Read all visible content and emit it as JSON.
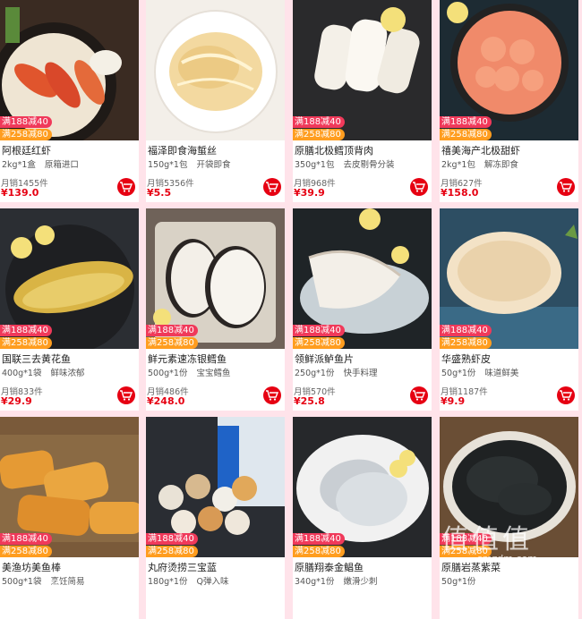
{
  "promo": {
    "tag1": "满188减40",
    "tag2": "满258减80"
  },
  "products": [
    {
      "title": "阿根廷红虾",
      "spec1": "2kg*1盒",
      "spec2": "原箱进口",
      "sales": "月销1455件",
      "price": "¥139.0",
      "image_icon": "red-shrimp-photo"
    },
    {
      "title": "福泽即食海蜇丝",
      "spec1": "150g*1包",
      "spec2": "开袋即食",
      "sales": "月销5356件",
      "price": "¥5.5",
      "image_icon": "jellyfish-photo"
    },
    {
      "title": "原膳北极鳕顶背肉",
      "spec1": "350g*1包",
      "spec2": "去皮剔骨分装",
      "sales": "月销968件",
      "price": "¥39.9",
      "image_icon": "cod-fillet-photo"
    },
    {
      "title": "禧美海产北极甜虾",
      "spec1": "2kg*1包",
      "spec2": "解冻即食",
      "sales": "月销627件",
      "price": "¥158.0",
      "image_icon": "sweet-shrimp-photo"
    },
    {
      "title": "国联三去黄花鱼",
      "spec1": "400g*1袋",
      "spec2": "鲜味浓郁",
      "sales": "月销833件",
      "price": "¥29.9",
      "image_icon": "yellow-croaker-photo"
    },
    {
      "title": "鲜元素速冻银鳕鱼",
      "spec1": "500g*1份",
      "spec2": "宝宝鳕鱼",
      "sales": "月销486件",
      "price": "¥248.0",
      "image_icon": "cod-steak-photo"
    },
    {
      "title": "领鲜派鲈鱼片",
      "spec1": "250g*1份",
      "spec2": "快手料理",
      "sales": "月销570件",
      "price": "¥25.8",
      "image_icon": "bass-fillet-photo"
    },
    {
      "title": "华盛熟虾皮",
      "spec1": "50g*1份",
      "spec2": "味道鲜美",
      "sales": "月销1187件",
      "price": "¥9.9",
      "image_icon": "dried-shrimp-photo"
    },
    {
      "title": "美渔坊美鱼棒",
      "spec1": "500g*1袋",
      "spec2": "烹饪简易",
      "sales": "",
      "price": "",
      "image_icon": "fish-stick-photo"
    },
    {
      "title": "丸府烫捞三宝蓝",
      "spec1": "180g*1份",
      "spec2": "Q弹入味",
      "sales": "",
      "price": "",
      "image_icon": "fish-ball-photo"
    },
    {
      "title": "原膳翔泰金鲳鱼",
      "spec1": "340g*1份",
      "spec2": "嫩滑少刺",
      "sales": "",
      "price": "",
      "image_icon": "pomfret-photo"
    },
    {
      "title": "原膳岩蒸紫菜",
      "spec1": "50g*1份",
      "spec2": "",
      "sales": "",
      "price": "",
      "image_icon": "seaweed-photo"
    }
  ],
  "watermark": {
    "main": "值值值",
    "sub": "smzdm.com"
  },
  "colors": {
    "accent_red": "#e60012",
    "promo_pink": "#f0395a",
    "promo_orange": "#ff9d1f"
  }
}
